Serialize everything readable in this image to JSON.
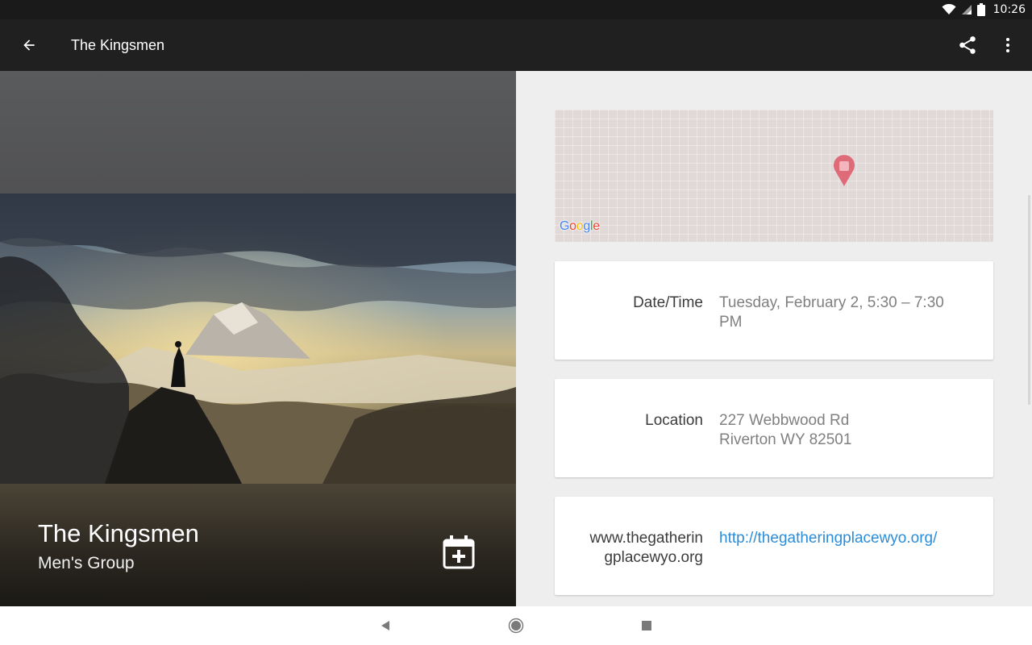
{
  "status_bar": {
    "time": "10:26",
    "wifi_icon": "wifi-icon",
    "signal_icon": "cell-signal-icon",
    "battery_icon": "battery-icon"
  },
  "app_bar": {
    "title": "The Kingsmen",
    "back_icon": "arrow-back-icon",
    "share_icon": "share-icon",
    "more_icon": "more-vert-icon"
  },
  "event": {
    "title": "The Kingsmen",
    "subtitle": "Men's Group",
    "add_calendar_icon": "calendar-add-icon"
  },
  "map": {
    "provider_logo_letters": [
      "G",
      "o",
      "o",
      "g",
      "l",
      "e"
    ],
    "pin_icon": "map-pin-icon"
  },
  "details": [
    {
      "label": "Date/Time",
      "value_lines": [
        "Tuesday, February 2, 5:30 – 7:30",
        "PM"
      ]
    },
    {
      "label": "Location",
      "value_lines": [
        "227 Webbwood Rd",
        "Riverton WY 82501"
      ]
    },
    {
      "label": "www.thegatheringplacewyo.org",
      "value_lines": [
        "http://thegatheringplacewyo.org/"
      ]
    }
  ],
  "colors": {
    "app_bar": "#202020",
    "link": "#2b8cd9",
    "map_pin": "#e06b78",
    "panel_bg": "#eeeeee"
  },
  "nav_bar": {
    "back_icon": "nav-back-icon",
    "home_icon": "nav-home-icon",
    "recents_icon": "nav-recents-icon"
  }
}
